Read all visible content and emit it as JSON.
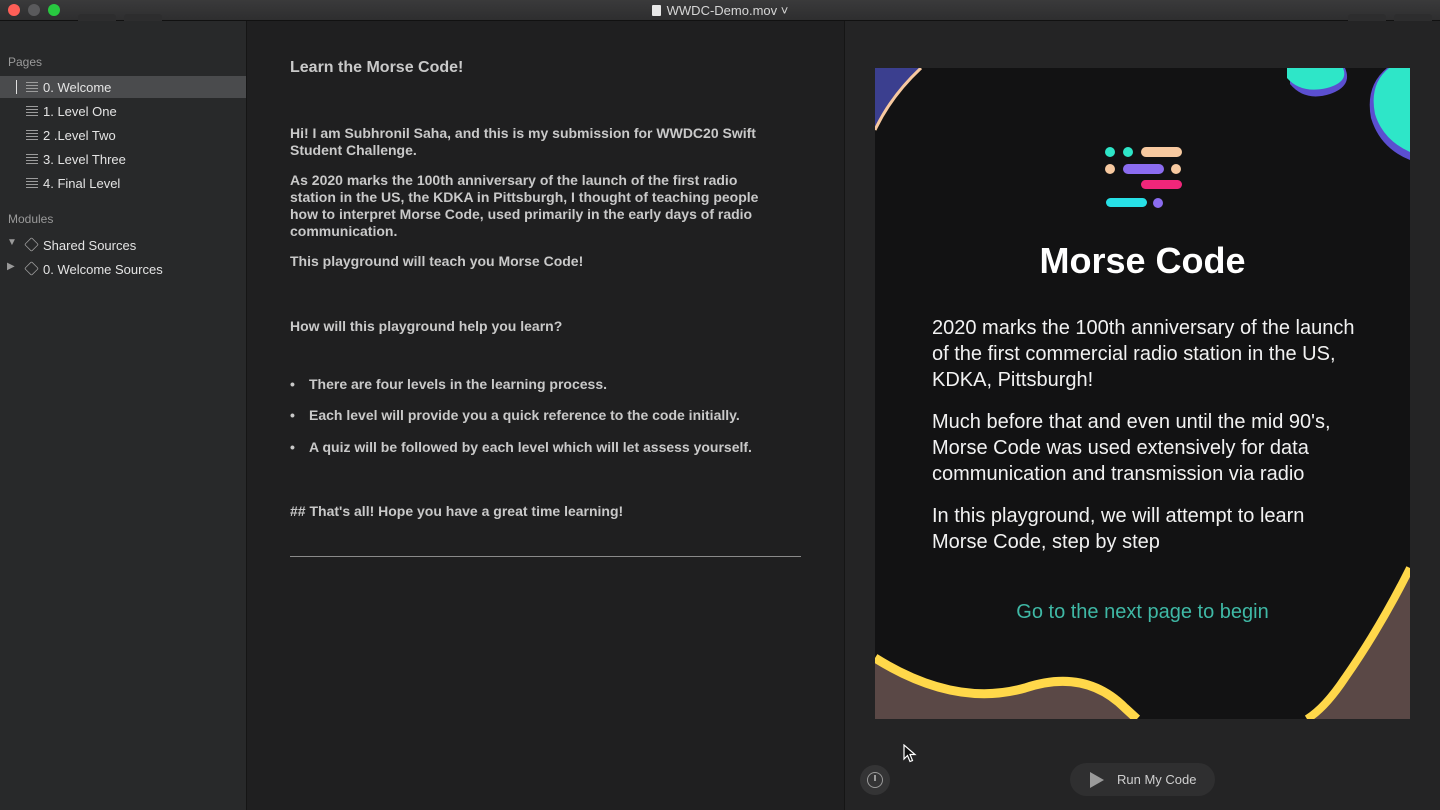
{
  "window": {
    "title": "WWDC-Demo.mov ˅",
    "traffic_lights": {
      "close": "#fe5f57",
      "minimize": "#febc2e",
      "zoom": "#28c840"
    }
  },
  "sidebar": {
    "pages_header": "Pages",
    "pages": [
      {
        "label": "0. Welcome",
        "selected": true
      },
      {
        "label": "1. Level One",
        "selected": false
      },
      {
        "label": "2 .Level Two",
        "selected": false
      },
      {
        "label": "3. Level Three",
        "selected": false
      },
      {
        "label": "4. Final Level",
        "selected": false
      }
    ],
    "modules_header": "Modules",
    "modules": [
      {
        "label": "Shared Sources",
        "expanded": true
      },
      {
        "label": "0. Welcome Sources",
        "expanded": false
      }
    ]
  },
  "editor": {
    "heading": "Learn the Morse Code!",
    "intro": "Hi! I am Subhronil Saha, and this is my submission for WWDC20 Swift Student Challenge.",
    "para2": "As 2020 marks the 100th anniversary of the launch of the first radio station in the US, the KDKA in Pittsburgh, I thought of teaching people how to interpret Morse Code, used primarily in the early days of radio communication.",
    "para3": "This playground will teach you Morse Code!",
    "subheading": "How will this playground help you learn?",
    "bullets": [
      "There are four levels in the learning process.",
      "Each level will provide you a quick reference to the code initially.",
      "A quiz will be followed by each level which will let assess yourself."
    ],
    "closing": "## That's all! Hope you have a great time learning!"
  },
  "live_view": {
    "title": "Morse Code",
    "paragraphs": [
      "2020 marks the 100th anniversary of the launch of the first commercial radio station in the US, KDKA, Pittsburgh!",
      "Much before that and even until the mid 90's, Morse Code was used extensively for data communication and transmission via radio",
      "In this playground, we will attempt to learn Morse Code, step by step"
    ],
    "next_link": "Go to the next page to begin",
    "colors": {
      "teal": "#2ee6c8",
      "peach": "#f7c9a0",
      "purple": "#8b6cf0",
      "pink": "#f0267a",
      "cyan": "#27e0e6",
      "yellow": "#ffd84a",
      "brown": "#5a4846",
      "blue": "#3b3f8f",
      "link": "#3fb8a5"
    }
  },
  "controls": {
    "timer_icon": "stopwatch-icon",
    "run_button_label": "Run My Code",
    "run_icon": "play-icon"
  }
}
